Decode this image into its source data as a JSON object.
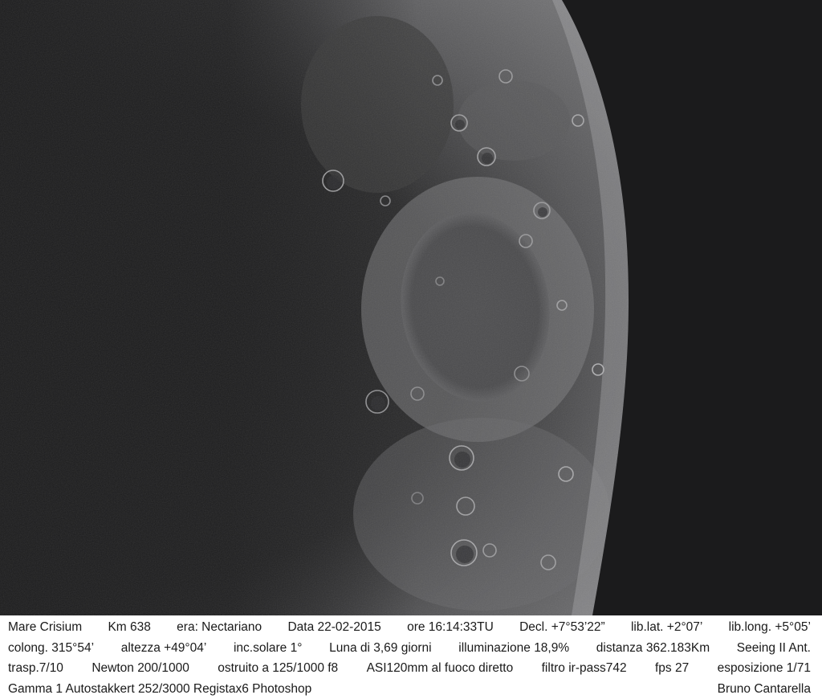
{
  "photo": {
    "subject": "Mare Crisium",
    "background_color": "#1b1b1c",
    "moon_color": "#6f6f71"
  },
  "caption": {
    "line1": [
      "Mare Crisium",
      "Km 638",
      "era:  Nectariano",
      "Data 22-02-2015",
      "ore 16:14:33TU",
      "Decl. +7°53’22”",
      "lib.lat. +2°07’",
      "lib.long. +5°05’"
    ],
    "line2": [
      "colong. 315°54’",
      "altezza +49°04’",
      "inc.solare 1°",
      "Luna di 3,69 giorni",
      "illuminazione 18,9%",
      "distanza 362.183Km",
      "Seeing II Ant."
    ],
    "line3": [
      "trasp.7/10",
      "Newton 200/1000",
      "ostruito a 125/1000 f8",
      "ASI120mm al fuoco diretto",
      "filtro ir-pass742",
      "fps 27",
      "esposizione 1/71"
    ],
    "line4_left": "Gamma 1  Autostakkert 252/3000 Registax6 Photoshop",
    "credit": "Bruno Cantarella"
  }
}
